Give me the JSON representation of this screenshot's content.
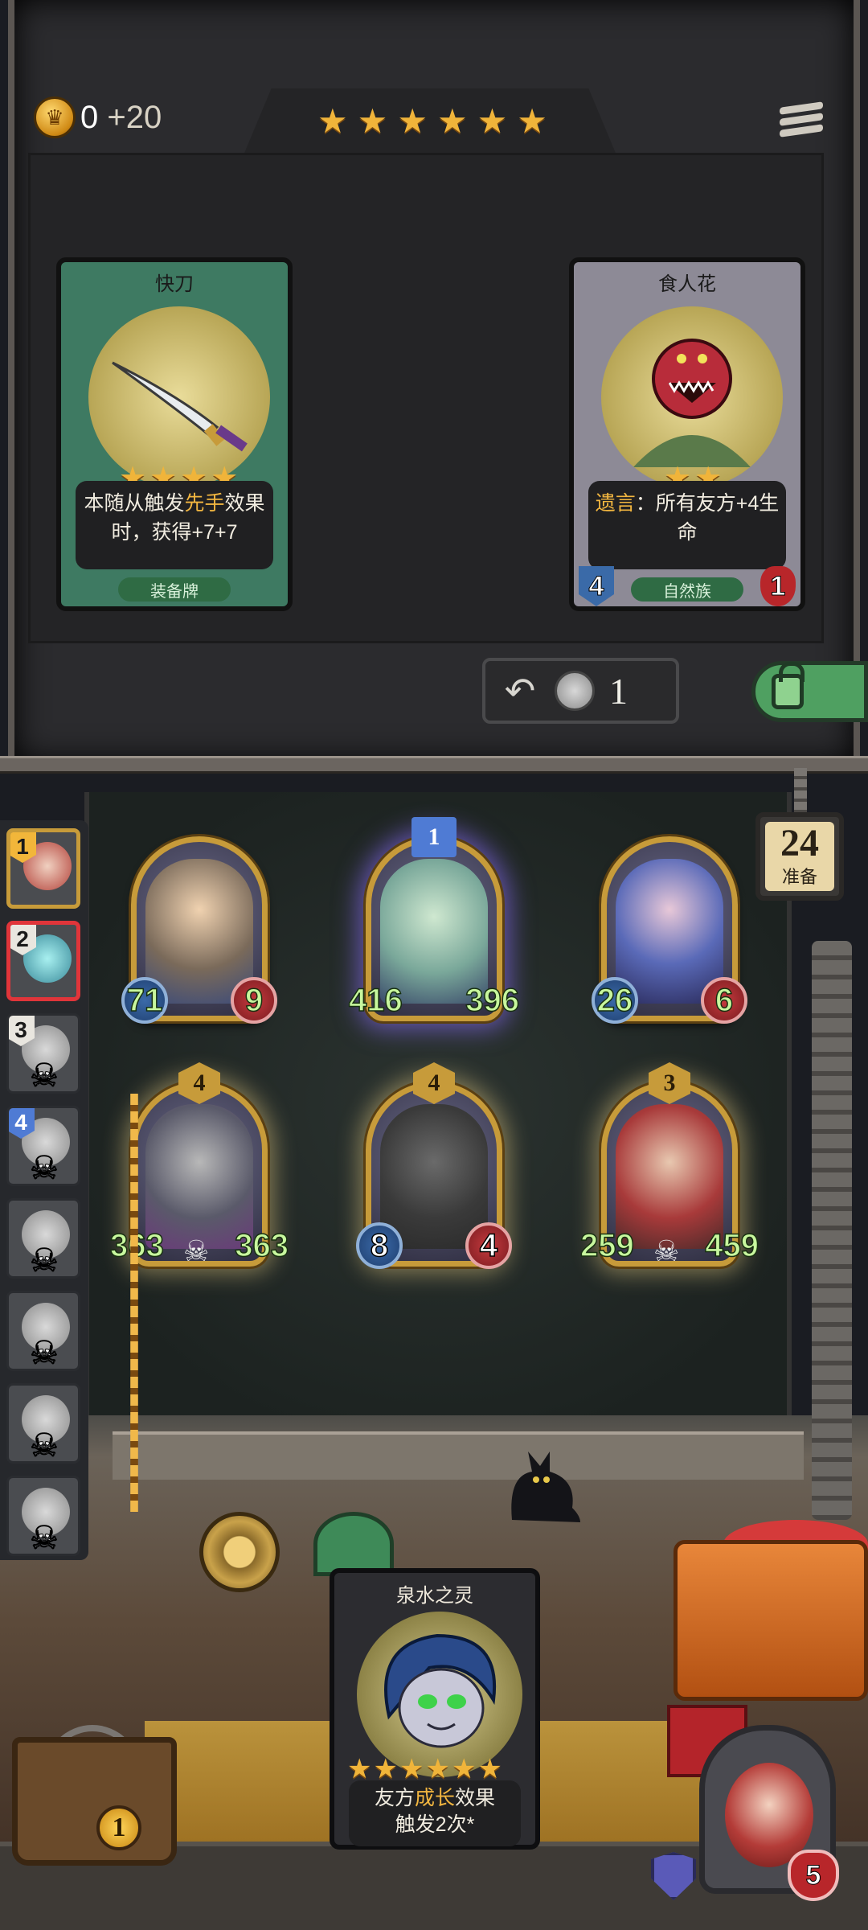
{
  "header": {
    "gold_current": "0",
    "gold_income": "+20",
    "tavern_stars": 6
  },
  "shop": {
    "cards": [
      {
        "name": "快刀",
        "stars": 4,
        "desc_prefix": "本随从触发",
        "desc_highlight": "先手",
        "desc_suffix": "效果时，获得+7+7",
        "type": "装备牌"
      },
      {
        "name": "食人花",
        "stars": 2,
        "desc_highlight": "遗言",
        "desc_suffix": "：所有友方+4生命",
        "type": "自然族",
        "attack": "4",
        "health": "1"
      }
    ],
    "refresh_cost": "1"
  },
  "timer": {
    "value": "24",
    "label": "准备"
  },
  "board": {
    "minions": [
      {
        "attack": "71",
        "health": "9"
      },
      {
        "tier": "1",
        "attack": "416",
        "health": "396"
      },
      {
        "attack": "26",
        "health": "6"
      },
      {
        "tier": "4",
        "attack": "363",
        "health": "363"
      },
      {
        "tier": "4",
        "attack": "8",
        "health": "4"
      },
      {
        "tier": "3",
        "attack": "259",
        "health": "459"
      }
    ]
  },
  "opponents": [
    {
      "rank": "1"
    },
    {
      "rank": "2"
    },
    {
      "rank": "3"
    },
    {
      "rank": "4"
    },
    {
      "rank": ""
    },
    {
      "rank": ""
    },
    {
      "rank": ""
    },
    {
      "rank": ""
    }
  ],
  "hand": {
    "card": {
      "name": "泉水之灵",
      "stars": 6,
      "desc_prefix": "友方",
      "desc_highlight": "成长",
      "desc_suffix": "效果",
      "desc_line2": "触发2次*"
    }
  },
  "chest_count": "1",
  "hero": {
    "health": "5"
  },
  "icons": {
    "gold": "crown-coin-icon",
    "menu": "menu-icon",
    "undo": "undo-icon",
    "refresh_coin": "silver-coin-icon",
    "lock": "unlock-icon",
    "skull": "skull-icon",
    "shield": "shield-icon"
  },
  "colors": {
    "star": "#f0b43a",
    "highlight": "#f2b640",
    "stat_text": "#c8f79e",
    "attack": "#3b6aa8",
    "health": "#c63a3e",
    "lock_btn": "#4fa061"
  }
}
